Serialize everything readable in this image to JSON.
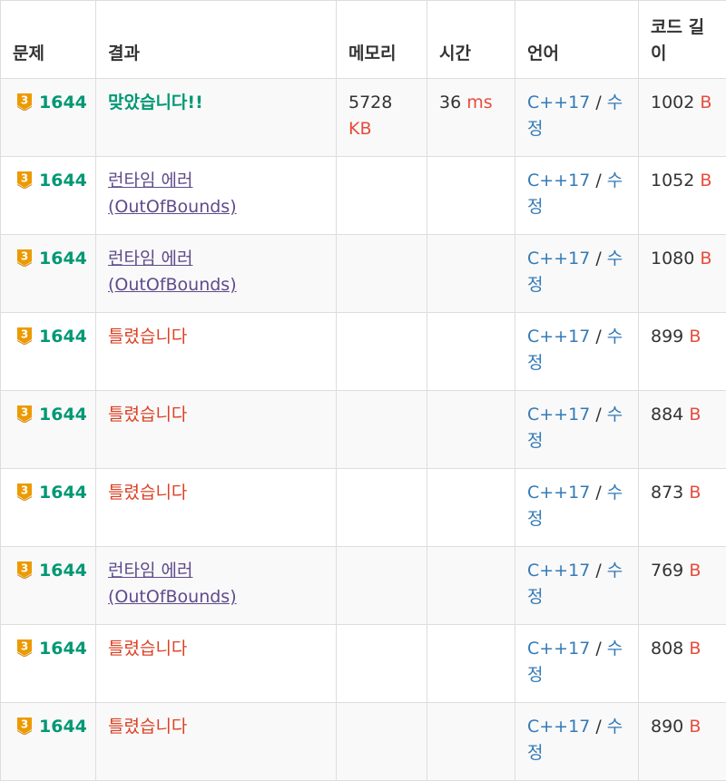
{
  "headers": [
    "문제",
    "결과",
    "메모리",
    "시간",
    "언어",
    "코드 길이"
  ],
  "tier_label": "3",
  "rows": [
    {
      "problem": "1644",
      "result": "맞았습니다!!",
      "result_type": "accepted",
      "memory": "5728",
      "memory_unit": "KB",
      "time": "36",
      "time_unit": "ms",
      "language": "C++17",
      "edit": "수정",
      "code_length": "1002",
      "length_unit": "B"
    },
    {
      "problem": "1644",
      "result": "런타임 에러 (OutOfBounds)",
      "result_type": "runtime",
      "memory": "",
      "memory_unit": "",
      "time": "",
      "time_unit": "",
      "language": "C++17",
      "edit": "수정",
      "code_length": "1052",
      "length_unit": "B"
    },
    {
      "problem": "1644",
      "result": "런타임 에러 (OutOfBounds)",
      "result_type": "runtime",
      "memory": "",
      "memory_unit": "",
      "time": "",
      "time_unit": "",
      "language": "C++17",
      "edit": "수정",
      "code_length": "1080",
      "length_unit": "B"
    },
    {
      "problem": "1644",
      "result": "틀렸습니다",
      "result_type": "wrong",
      "memory": "",
      "memory_unit": "",
      "time": "",
      "time_unit": "",
      "language": "C++17",
      "edit": "수정",
      "code_length": "899",
      "length_unit": "B"
    },
    {
      "problem": "1644",
      "result": "틀렸습니다",
      "result_type": "wrong",
      "memory": "",
      "memory_unit": "",
      "time": "",
      "time_unit": "",
      "language": "C++17",
      "edit": "수정",
      "code_length": "884",
      "length_unit": "B"
    },
    {
      "problem": "1644",
      "result": "틀렸습니다",
      "result_type": "wrong",
      "memory": "",
      "memory_unit": "",
      "time": "",
      "time_unit": "",
      "language": "C++17",
      "edit": "수정",
      "code_length": "873",
      "length_unit": "B"
    },
    {
      "problem": "1644",
      "result": "런타임 에러 (OutOfBounds)",
      "result_type": "runtime",
      "memory": "",
      "memory_unit": "",
      "time": "",
      "time_unit": "",
      "language": "C++17",
      "edit": "수정",
      "code_length": "769",
      "length_unit": "B"
    },
    {
      "problem": "1644",
      "result": "틀렸습니다",
      "result_type": "wrong",
      "memory": "",
      "memory_unit": "",
      "time": "",
      "time_unit": "",
      "language": "C++17",
      "edit": "수정",
      "code_length": "808",
      "length_unit": "B"
    },
    {
      "problem": "1644",
      "result": "틀렸습니다",
      "result_type": "wrong",
      "memory": "",
      "memory_unit": "",
      "time": "",
      "time_unit": "",
      "language": "C++17",
      "edit": "수정",
      "code_length": "890",
      "length_unit": "B"
    }
  ],
  "colors": {
    "accepted": "#009874",
    "wrong": "#dd4124",
    "runtime": "#5f4b8b",
    "language_link": "#337ab7",
    "unit": "#e74c3c",
    "tier_badge": "#ec9a00"
  },
  "icons": {
    "tier": "gold-tier-3-badge-icon"
  }
}
